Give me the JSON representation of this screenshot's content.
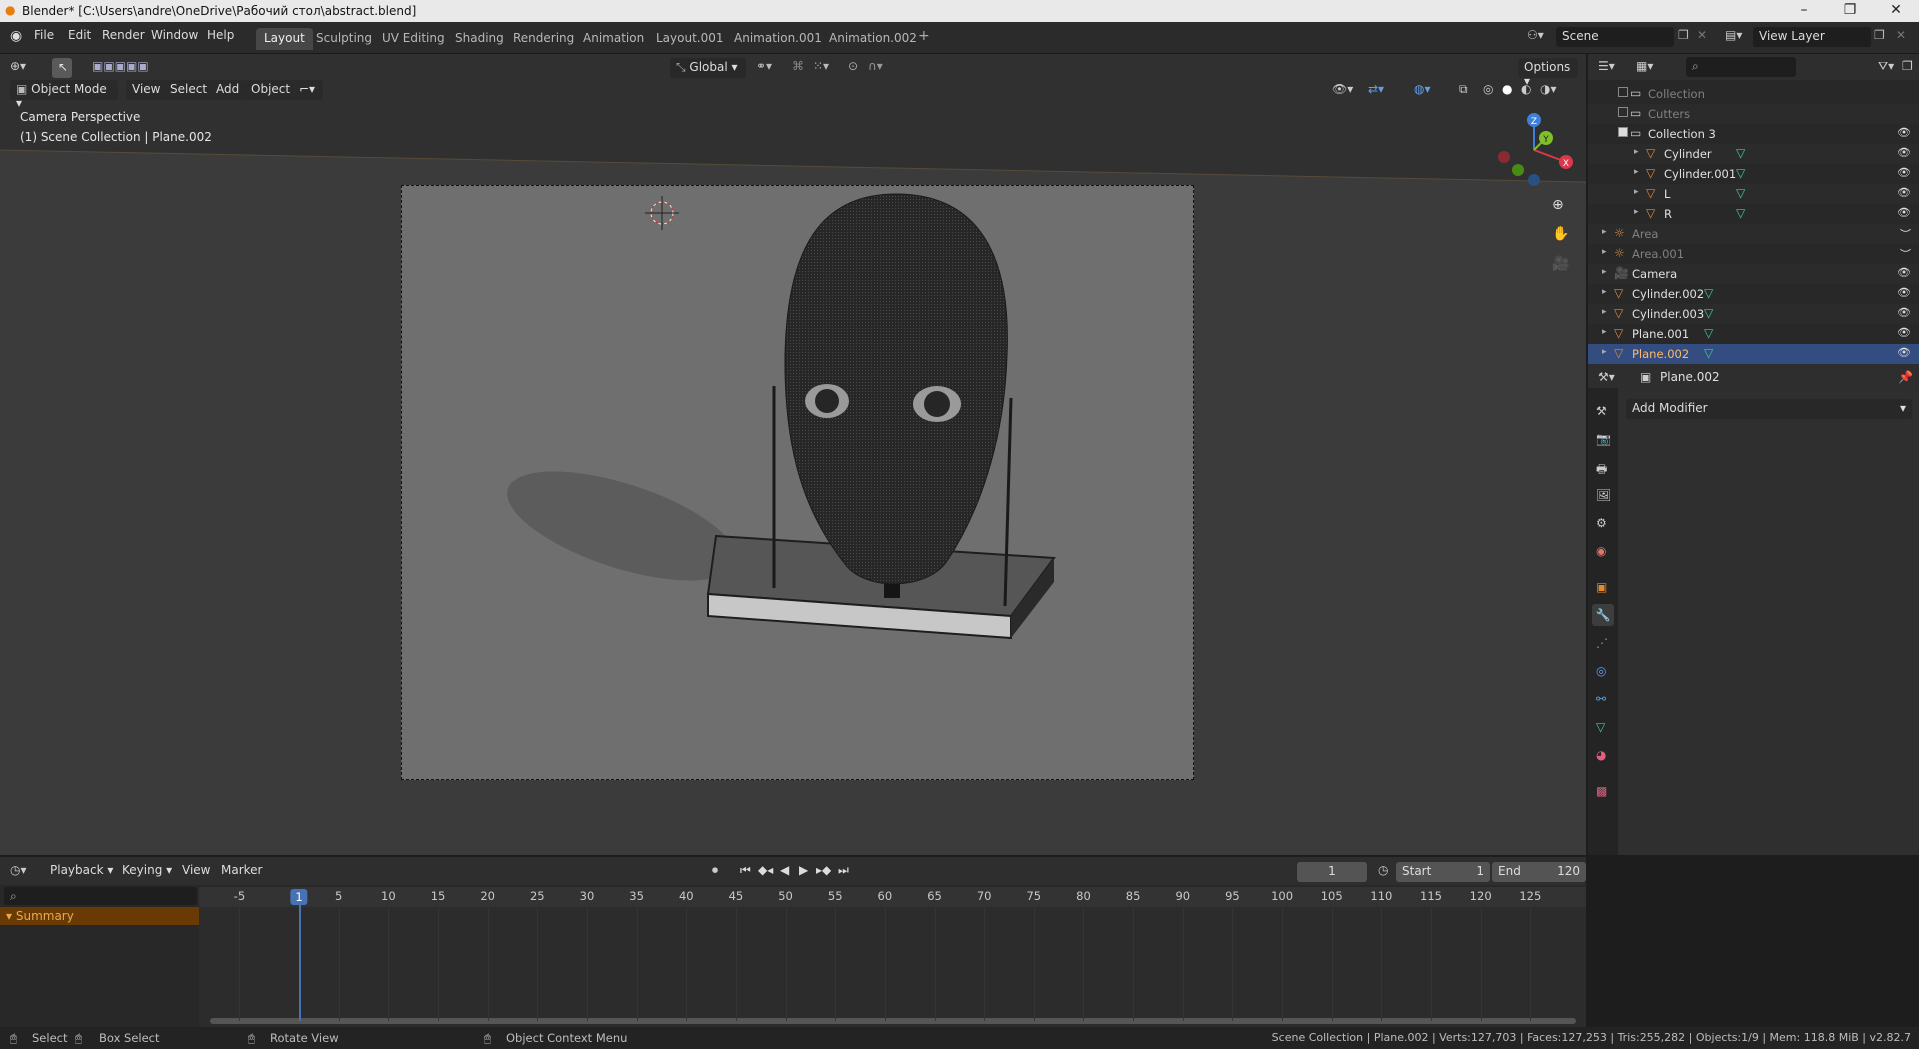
{
  "titlebar": {
    "title": "Blender* [C:\\Users\\andre\\OneDrive\\Рабочий стол\\abstract.blend]"
  },
  "menu": [
    "File",
    "Edit",
    "Render",
    "Window",
    "Help"
  ],
  "workspaces": [
    "Layout",
    "Sculpting",
    "UV Editing",
    "Shading",
    "Rendering",
    "Animation",
    "Layout.001",
    "Animation.001",
    "Animation.002"
  ],
  "active_workspace": "Layout",
  "scene": "Scene",
  "view_layer": "View Layer",
  "viewport": {
    "transform_orientation": "Global",
    "options": "Options",
    "mode": "Object Mode",
    "menus": [
      "View",
      "Select",
      "Add",
      "Object"
    ],
    "overlay_line1": "Camera Perspective",
    "overlay_line2": "(1) Scene Collection | Plane.002",
    "gizmo": {
      "z": "Z",
      "y": "Y",
      "x": "X"
    }
  },
  "outliner": {
    "rows": [
      {
        "name": "Collection",
        "kind": "collection",
        "dim": true
      },
      {
        "name": "Cutters",
        "kind": "collection",
        "dim": true
      },
      {
        "name": "Collection 3",
        "kind": "collection"
      },
      {
        "name": "Cylinder",
        "kind": "mesh"
      },
      {
        "name": "Cylinder.001",
        "kind": "mesh"
      },
      {
        "name": "L",
        "kind": "mesh"
      },
      {
        "name": "R",
        "kind": "mesh"
      },
      {
        "name": "Area",
        "kind": "light",
        "dim": true
      },
      {
        "name": "Area.001",
        "kind": "light",
        "dim": true
      },
      {
        "name": "Camera",
        "kind": "camera"
      },
      {
        "name": "Cylinder.002",
        "kind": "mesh"
      },
      {
        "name": "Cylinder.003",
        "kind": "mesh"
      },
      {
        "name": "Plane.001",
        "kind": "mesh"
      },
      {
        "name": "Plane.002",
        "kind": "mesh",
        "selected": true
      }
    ]
  },
  "properties": {
    "object": "Plane.002",
    "add_modifier": "Add Modifier"
  },
  "timeline": {
    "menus": [
      "Playback",
      "Keying",
      "View",
      "Marker"
    ],
    "current_frame": "1",
    "start_label": "Start",
    "start": "1",
    "end_label": "End",
    "end": "120",
    "summary": "Summary",
    "ticks": [
      "-5",
      "1",
      "5",
      "10",
      "15",
      "20",
      "25",
      "30",
      "35",
      "40",
      "45",
      "50",
      "55",
      "60",
      "65",
      "70",
      "75",
      "80",
      "85",
      "90",
      "95",
      "100",
      "105",
      "110",
      "115",
      "120",
      "125"
    ]
  },
  "statusbar": {
    "select": "Select",
    "box_select": "Box Select",
    "rotate": "Rotate View",
    "context": "Object Context Menu",
    "stats": "Scene Collection | Plane.002 | Verts:127,703 | Faces:127,253 | Tris:255,282 | Objects:1/9 | Mem: 118.8 MiB | v2.82.7"
  }
}
